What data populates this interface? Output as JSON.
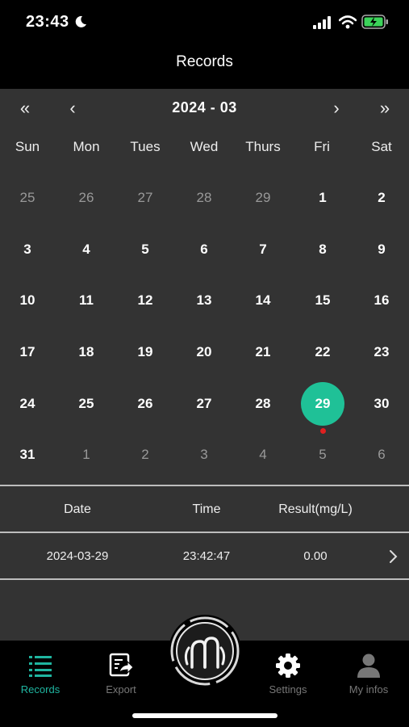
{
  "status": {
    "time": "23:43"
  },
  "header": {
    "title": "Records"
  },
  "calendar": {
    "month_label": "2024 - 03",
    "nav": {
      "prev_year": "«",
      "prev_month": "‹",
      "next_month": "›",
      "next_year": "»"
    },
    "weekdays": [
      "Sun",
      "Mon",
      "Tues",
      "Wed",
      "Thurs",
      "Fri",
      "Sat"
    ],
    "weeks": [
      [
        "25",
        "26",
        "27",
        "28",
        "29",
        "1",
        "2"
      ],
      [
        "3",
        "4",
        "5",
        "6",
        "7",
        "8",
        "9"
      ],
      [
        "10",
        "11",
        "12",
        "13",
        "14",
        "15",
        "16"
      ],
      [
        "17",
        "18",
        "19",
        "20",
        "21",
        "22",
        "23"
      ],
      [
        "24",
        "25",
        "26",
        "27",
        "28",
        "29",
        "30"
      ],
      [
        "31",
        "1",
        "2",
        "3",
        "4",
        "5",
        "6"
      ]
    ],
    "selected_day": "29"
  },
  "table": {
    "headers": {
      "date": "Date",
      "time": "Time",
      "result": "Result(mg/L)"
    },
    "rows": [
      {
        "date": "2024-03-29",
        "time": "23:42:47",
        "result": "0.00"
      }
    ]
  },
  "tabs": [
    {
      "label": "Records",
      "icon": "list-icon",
      "active": true
    },
    {
      "label": "Export",
      "icon": "export-icon",
      "active": false
    },
    {
      "label": "Settings",
      "icon": "gear-icon",
      "active": false
    },
    {
      "label": "My infos",
      "icon": "person-icon",
      "active": false
    }
  ],
  "colors": {
    "accent": "#1fc197",
    "tab_active": "#1fb5a0",
    "marker": "#e02020",
    "panel": "#333333"
  }
}
